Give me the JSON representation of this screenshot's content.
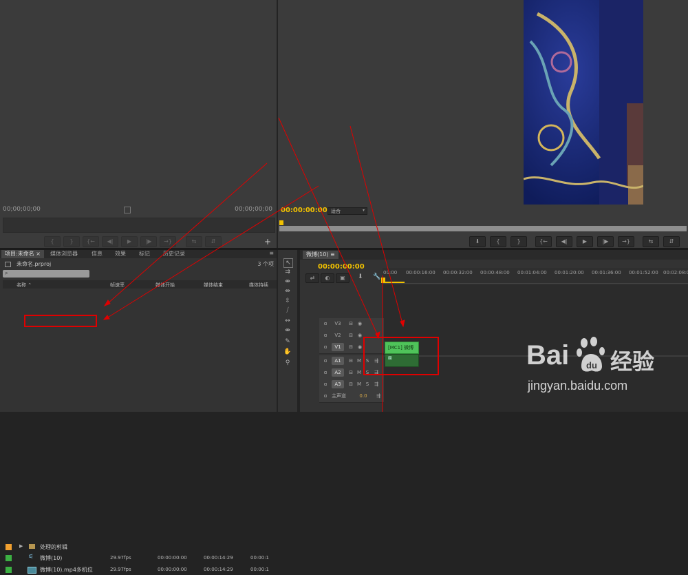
{
  "source_monitor": {
    "timecode_left": "00;00;00;00",
    "timecode_right": "00;00;00;00",
    "buttons": [
      "{",
      "}",
      "{←",
      "◀|",
      "▶",
      "|▶",
      "→}",
      "⇆",
      "⇵"
    ]
  },
  "program_monitor": {
    "timecode": "00:00:00:00",
    "fit_label": "适合",
    "buttons": [
      "⬇",
      "{",
      "}",
      "{←",
      "◀|",
      "▶",
      "|▶",
      "→}",
      "⇆",
      "⇵"
    ]
  },
  "project_panel": {
    "tabs": [
      "项目:未命名 ×",
      "媒体浏览器",
      "信息",
      "效果",
      "标记",
      "历史记录"
    ],
    "project_file": "未命名.prproj",
    "item_count": "3 个项",
    "columns": [
      "名称 ⌃",
      "帧速率",
      "媒体开始",
      "媒体结束",
      "媒体持续"
    ],
    "rows": [
      {
        "label_color": "#f0a030",
        "name": "处理的剪辑",
        "fps": "",
        "start": "",
        "end": "",
        "dur": "",
        "kind": "folder-icon"
      },
      {
        "label_color": "#3cb043",
        "name": "微博(10)",
        "fps": "29.97fps",
        "start": "00:00:00:00",
        "end": "00:00:14:29",
        "dur": "00:00:1",
        "kind": "multicam-icon"
      },
      {
        "label_color": "#3cb043",
        "name": "微博(10).mp4多机位",
        "fps": "29.97fps",
        "start": "00:00:00:00",
        "end": "00:00:14:29",
        "dur": "00:00:1",
        "kind": "sequence-icon"
      }
    ]
  },
  "timeline": {
    "tab": "微博(10) ≡",
    "timecode": "00:00:00:00",
    "ruler": [
      "00:00",
      "00:00:16:00",
      "00:00:32:00",
      "00:00:48:00",
      "00:01:04:00",
      "00:01:20:00",
      "00:01:36:00",
      "00:01:52:00",
      "00:02:08:0"
    ],
    "video_tracks": [
      "V3",
      "V2",
      "V1"
    ],
    "audio_tracks": [
      "A1",
      "A2",
      "A3"
    ],
    "master_label": "主声道",
    "master_value": "0.0",
    "clip_video_label": "[MC1] 微博",
    "clip_audio_label": "⊠",
    "track_buttons": {
      "lock": "🔒",
      "sync": "⊟",
      "eye": "◉",
      "mute": "M",
      "solo": "S",
      "voice": "🎤"
    }
  },
  "watermark": {
    "brand": "Bai",
    "brand_tail": "经验",
    "url": "jingyan.baidu.com",
    "paw_icon": "paw-icon"
  },
  "colors": {
    "accent_yellow": "#f2c200",
    "clip_green": "#4fc35a",
    "annotation_red": "#e00000"
  }
}
